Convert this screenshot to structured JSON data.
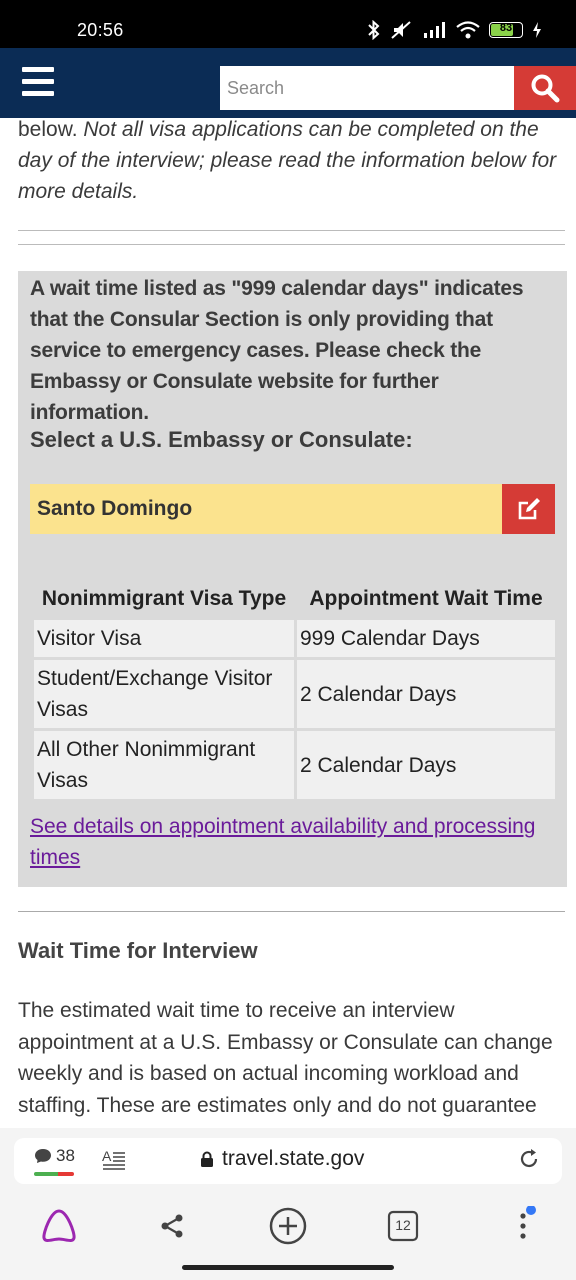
{
  "status_bar": {
    "time": "20:56",
    "battery": "83",
    "icons": [
      "bluetooth-icon",
      "mute-icon",
      "signal-icon",
      "wifi-icon",
      "battery-icon",
      "charging-icon"
    ]
  },
  "header": {
    "menu_icon": "hamburger-icon",
    "search_placeholder": "Search",
    "search_icon": "search-icon",
    "colors": {
      "bar": "#0b2c55",
      "search_button": "#d53b36"
    }
  },
  "intro": {
    "plain": "below. ",
    "italic": "Not all visa applications can be completed on the day of the interview; please read the information below for more details."
  },
  "panel": {
    "note": "A wait time listed as \"999 calendar days\" indicates that the Consular Section is only providing that service to emergency cases.  Please check the Embassy or Consulate website for further information.",
    "select_label": "Select a U.S. Embassy or Consulate:",
    "selected_post": "Santo Domingo",
    "edit_icon": "edit-icon",
    "table": {
      "headers": [
        "Nonimmigrant Visa Type",
        "Appointment Wait Time"
      ],
      "rows": [
        {
          "type": "Visitor Visa",
          "wait": "999 Calendar Days"
        },
        {
          "type": "Student/Exchange Visitor Visas",
          "wait": "2 Calendar Days"
        },
        {
          "type": "All Other Nonimmigrant Visas",
          "wait": "2 Calendar Days"
        }
      ]
    },
    "details_link": "See details on appointment availability and processing times"
  },
  "section": {
    "title": "Wait Time for Interview",
    "body": "The estimated wait time to receive an interview appointment at a U.S. Embassy or Consulate can change weekly and is based on actual incoming workload and staffing. These are estimates only and do not guarantee"
  },
  "browser": {
    "comment_count": "38",
    "url": "travel.state.gov",
    "tabs_count": "12",
    "icons": [
      "comments-icon",
      "reader-mode-icon",
      "lock-icon",
      "reload-icon",
      "alice-icon",
      "share-icon",
      "new-tab-icon",
      "tabs-icon",
      "more-icon"
    ]
  }
}
